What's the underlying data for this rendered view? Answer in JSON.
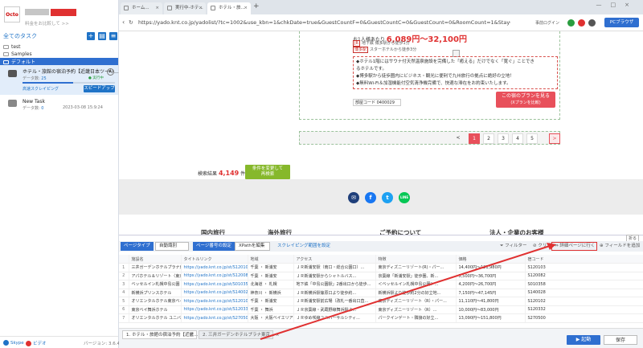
{
  "sidebar": {
    "logo_text": "Octo",
    "user_sub": "料金をお比較して >>",
    "task_header": "全てのタスク",
    "folders": [
      "test",
      "Samples",
      "デフォルト"
    ],
    "task1": {
      "name": "ホテル・旅館の宿泊予約【近畿日本ツーリ...",
      "data_label": "データ数:",
      "data_count": "25",
      "status": "● 実行中",
      "progress": 0.55,
      "link": "高速スクレイピング",
      "button": "スピードアップ"
    },
    "task2": {
      "name": "New Task",
      "data_label": "データ数:",
      "data_count": "0",
      "date": "2023-03-08 15:9:24"
    },
    "footer": {
      "skype": "Skype",
      "video": "ビデオ",
      "version": "バージョン: 3.6.4"
    }
  },
  "browser": {
    "tabs": [
      "ホーム...",
      "実行中-ホテ...",
      "ホテル・旅..."
    ],
    "url": "https://yado.knt.co.jp/yadolist/?tc=1002&use_kbn=1&chkDate=true&GuestCountF=0&GuestCountC=0&GuestCount=0&RoomCount=1&StayC...",
    "login": "事前ログイン",
    "pc_browser": "PCブラウザ"
  },
  "hotel": {
    "price_prefix": "お1人様あたり",
    "price": "6,089円〜32,100円",
    "tag1": "地下鉄 博多駅から徒歩1分",
    "tag1_badge": "JR",
    "tag2": "スターホテルから徒歩3分",
    "tag2_badge": "博多駅",
    "desc": [
      "◆ホテル1階にはサウナ付天然温泉施設を完備した「癒える」だけでなく「寛ぐ」ことでき",
      "るホテルです。",
      "◆博多駅から徒歩圏内にビジネス・観光に便利で九州旅行の拠点に絶好の立地！",
      "◆無料Wi-Fi＆加湿機能付空気清浄機完備で、快適な滞在をお約束いたします。"
    ],
    "room_code_label": "部屋コード",
    "room_code": "0400029",
    "plan_button": "この宿のプランを見る",
    "plan_button_sub": "(Xプランを比較)"
  },
  "pager": [
    "<",
    "1",
    "2",
    "3",
    "4",
    "5",
    ">"
  ],
  "search": {
    "label": "検索結果",
    "count": "4,149",
    "unit": "件",
    "cond_line1": "条件を変更して",
    "cond_line2": "再検索"
  },
  "footer_nav": [
    "国内旅行",
    "海外旅行",
    "ご予約について",
    "法人・企業のお客様"
  ],
  "panel": {
    "type_btn": "ページタイプ",
    "type_sel": "自動識別",
    "pager_btn": "ページ番号の設定",
    "pager_sel": "XPathを編集",
    "scrape_link": "スクレイピング範囲を設定",
    "filter": "フィルター",
    "clear": "クリア",
    "detail": "詳細ページに行く",
    "add_field": "フィールドを追加",
    "fold": "折る",
    "columns": [
      "",
      "施設名",
      "タイトルリンク",
      "地域",
      "アクセス",
      "特徴",
      "価格",
      "宿コード"
    ],
    "rows": [
      [
        "1",
        "三井ガーデンホテルプラナ東京ベイ",
        "https://yado.knt.co.jp/st/S120103/?Gue...",
        "千葉 ・ 新浦安",
        "ＪＲ新浦安駅（南口・総合公園口）...",
        "東京ディズニーリゾート(R)・パー...",
        "14,400円〜121,980円",
        "S120103"
      ],
      [
        "2",
        "アパホテル＆リゾート〈東京ベイ潮...",
        "https://yado.knt.co.jp/st/S120082/?Gue...",
        "千葉 ・ 新浦安",
        "ＪＲ新浦安駅からシャトルバス...",
        "京葉線「新浦安駅」徒歩圏、新...",
        "5,500円〜36,700円",
        "S120082"
      ],
      [
        "3",
        "ベッセルイン札幌中島公園",
        "https://yado.knt.co.jp/st/S010358/?Gue...",
        "北海道 ・ 札幌",
        "地下鉄「中島公園駅」2番出口から徒歩...",
        "＜ベッセルイン札幌中島公園＞...",
        "4,200円〜26,700円",
        "S010358"
      ],
      [
        "4",
        "新横浜プリンスホテル",
        "https://yado.knt.co.jp/st/S140028/?Gue...",
        "神奈川 ・ 新横浜",
        "ＪＲ新横浜駅篠原口より徒歩約...",
        "新横浜駅より徒歩約2分の好立地...",
        "7,150円〜47,145円",
        "S140028"
      ],
      [
        "5",
        "オリエンタルホテル東京ベイ",
        "https://yado.knt.co.jp/st/S120102/?Gue...",
        "千葉 ・ 新浦安",
        "ＪＲ新浦安駅前広場（改札一番出口直...",
        "東京ディズニーリゾート（R）・パー...",
        "11,110円〜41,800円",
        "S120102"
      ],
      [
        "6",
        "東京ベイ舞浜ホテル",
        "https://yado.knt.co.jp/st/S120332/?Gue...",
        "千葉 ・ 舞浜",
        "ＪＲ京葉線・武蔵野線舞浜駅よ...",
        "東京ディズニーリゾート（R）...",
        "10,000円〜83,000円",
        "S120332"
      ],
      [
        "7",
        "オリエンタルホテル ユニバーサル・...",
        "https://yado.knt.co.jp/st/S270500/?Gue...",
        "大阪 ・ 大阪ベイエリア",
        "ＪＲゆめ咲線ユニバーサルシティ...",
        "パークインゲート・隣接の好立...",
        "13,090円〜151,800円",
        "S270500"
      ]
    ]
  },
  "bottom": {
    "tab1": "1. ホテル・旅館の宿泊予約【近畿...",
    "tab2": "2. 三井ガーデンホテルプラナ東京...",
    "run": "▶ 起動",
    "save": "保存"
  },
  "colors": {
    "accent": "#2f6fd0",
    "price_red": "#e03131",
    "plan_btn": "#e8505b",
    "green_btn": "#86b82b"
  }
}
